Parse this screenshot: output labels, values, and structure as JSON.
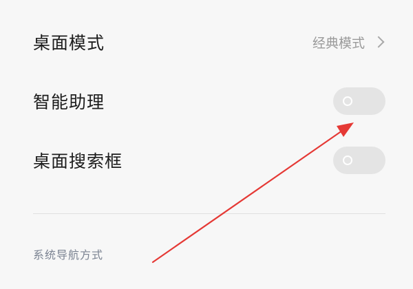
{
  "settings": {
    "desktop_mode": {
      "label": "桌面模式",
      "value": "经典模式"
    },
    "smart_assistant": {
      "label": "智能助理",
      "enabled": false
    },
    "desktop_search_box": {
      "label": "桌面搜索框",
      "enabled": false
    },
    "nav_section_title": "系统导航方式"
  },
  "icons": {
    "chevron": "chevron-right-icon",
    "annotation": "red-arrow-annotation"
  },
  "colors": {
    "arrow": "#e53935",
    "toggle_off": "#e4e4e4",
    "background": "#f7f7f7"
  }
}
